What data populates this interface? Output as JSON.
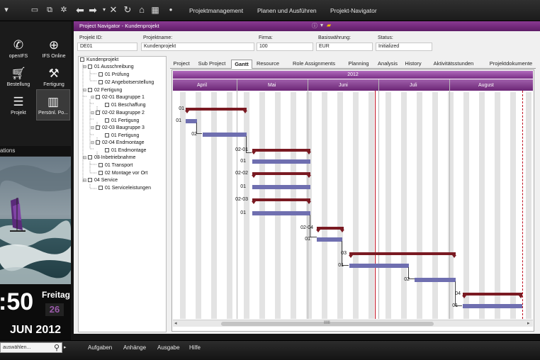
{
  "topbar": {
    "nav_links": [
      "Projektmanagement",
      "Planen und Ausführen",
      "Projekt-Navigator"
    ]
  },
  "sidebar": {
    "buttons": [
      {
        "label": "openIFS",
        "icon": "phone-icon"
      },
      {
        "label": "IFS Online",
        "icon": "globe-icon"
      },
      {
        "label": "Bestellung",
        "icon": "cart-icon"
      },
      {
        "label": "Fertigung",
        "icon": "wrench-icon"
      },
      {
        "label": "Projekt",
        "icon": "list-icon"
      },
      {
        "label": "Persönl. Po...",
        "icon": "bar-chart-icon"
      }
    ],
    "ops_label": "ations"
  },
  "clock": {
    "time": ":50",
    "weekday": "Freitag",
    "day": "26",
    "date": "JUN 2012"
  },
  "bottom": {
    "search_placeholder": "auswählen...",
    "buttons": [
      "Aufgaben",
      "Anhänge",
      "Ausgabe",
      "Hilfe"
    ]
  },
  "window": {
    "title": "Project Navigator - Kundenprojekt",
    "fields": {
      "projekt_id_label": "Projekt ID:",
      "projekt_id": "DE01",
      "projektname_label": "Projektname:",
      "projektname": "Kundenprojekt",
      "firma_label": "Firma:",
      "firma": "100",
      "waehrung_label": "Basiswährung:",
      "waehrung": "EUR",
      "status_label": "Status:",
      "status": "Initialized"
    },
    "tabs": [
      "Project",
      "Sub Project",
      "Gantt",
      "Resource",
      "Role Assignments",
      "Planning",
      "Analysis",
      "History",
      "Aktivitätsstunden",
      "Projektdokumente"
    ],
    "active_tab": "Gantt"
  },
  "tree": {
    "root": "Kundenprojekt",
    "nodes": [
      "01 Ausschreibung",
      "01 Prüfung",
      "02 Angebotserstellung",
      "02 Fertigung",
      "02-01 Baugruppe 1",
      "01 Beschaffung",
      "02-02 Baugruppe 2",
      "01 Fertigung",
      "02-03 Baugruppe 3",
      "01 Fertigung",
      "02-04 Endmontage",
      "01 Endmontage",
      "03 Inbetriebnahme",
      "01 Transport",
      "02 Montage vor Ort",
      "04 Service",
      "01 Serviceleistungen"
    ]
  },
  "gantt": {
    "year": "2012",
    "months": [
      "April",
      "Mai",
      "Juni",
      "Juli",
      "August"
    ],
    "bar_labels": [
      "01",
      "01",
      "02",
      "02-01",
      "01",
      "02-02",
      "01",
      "02-03",
      "01",
      "02-04",
      "01",
      "03",
      "01",
      "02",
      "04",
      "01"
    ],
    "scroll_grip": "ⅡⅡⅡ"
  }
}
